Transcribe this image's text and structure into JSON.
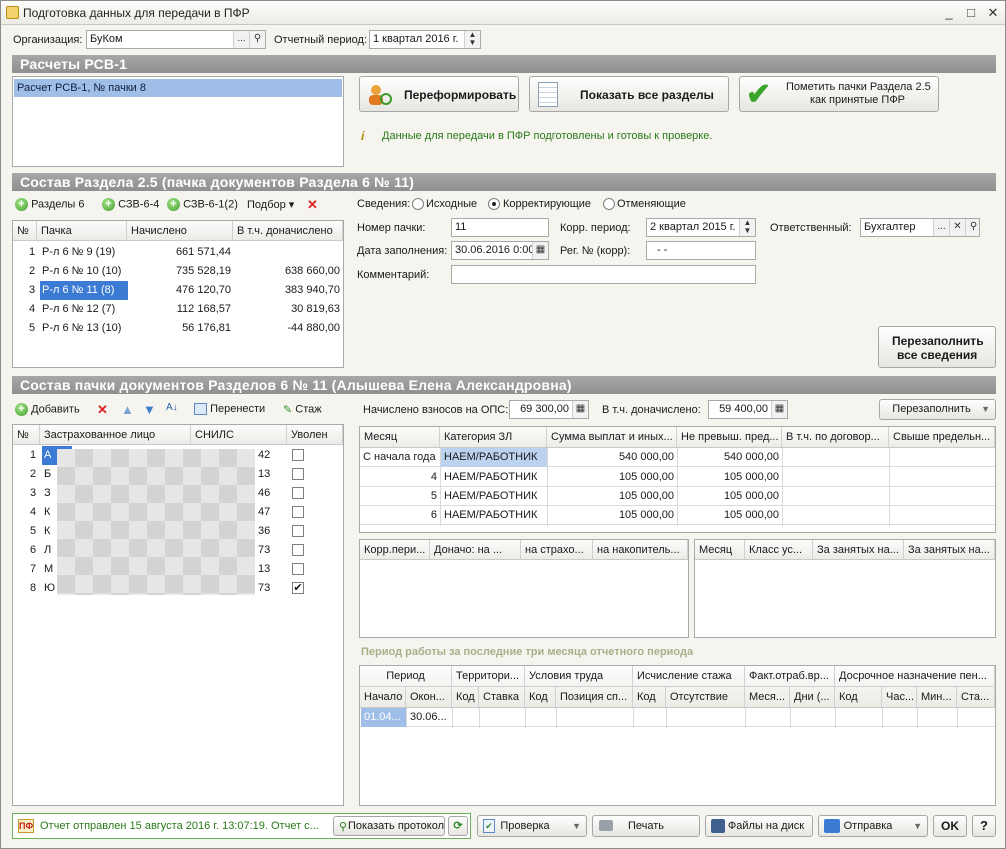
{
  "window": {
    "title": "Подготовка данных для передачи в ПФР"
  },
  "header": {
    "org_label": "Организация:",
    "org_value": "БуКом",
    "period_label": "Отчетный период:",
    "period_value": "1 квартал 2016 г."
  },
  "rsv": {
    "section_title": "Расчеты РСВ-1",
    "list_items": [
      "Расчет РСВ-1, № пачки 8"
    ],
    "reformat_label": "Переформировать",
    "show_all_label": "Показать все разделы",
    "mark_accepted_label_1": "Пометить пачки Раздела 2.5",
    "mark_accepted_label_2": "как принятые ПФР",
    "info_text": "Данные для передачи в ПФР подготовлены и готовы к проверке."
  },
  "section25": {
    "title": "Состав Раздела 2.5     (пачка документов Раздела 6 № 11)",
    "toolbar": {
      "razdely": "Разделы 6",
      "szv64": "СЗВ-6-4",
      "szv612": "СЗВ-6-1(2)",
      "podbor": "Подбор"
    },
    "columns": [
      "№",
      "Пачка",
      "Начислено",
      "В т.ч. доначислено"
    ],
    "rows": [
      {
        "n": "1",
        "pack": "Р-л 6 № 9 (19)",
        "accrued": "661 571,44",
        "extra": ""
      },
      {
        "n": "2",
        "pack": "Р-л 6 № 10 (10)",
        "accrued": "735 528,19",
        "extra": "638 660,00"
      },
      {
        "n": "3",
        "pack": "Р-л 6 № 11 (8)",
        "accrued": "476 120,70",
        "extra": "383 940,70"
      },
      {
        "n": "4",
        "pack": "Р-л 6 № 12 (7)",
        "accrued": "112 168,57",
        "extra": "30 819,63"
      },
      {
        "n": "5",
        "pack": "Р-л 6 № 13 (10)",
        "accrued": "56 176,81",
        "extra": "-44 880,00"
      }
    ],
    "svedeniya_label": "Сведения:",
    "radio_original": "Исходные",
    "radio_corrective": "Корректирующие",
    "radio_cancel": "Отменяющие",
    "pack_no_label": "Номер пачки:",
    "pack_no_value": "11",
    "corr_period_label": "Корр. период:",
    "corr_period_value": "2 квартал 2015 г.",
    "responsible_label": "Ответственный:",
    "responsible_value": "Бухгалтер",
    "fill_date_label": "Дата заполнения:",
    "fill_date_value": "30.06.2016  0:00",
    "reg_no_label": "Рег. № (корр):",
    "reg_no_value": "-   -",
    "comment_label": "Комментарий:",
    "comment_value": "",
    "refill_all_1": "Перезаполнить",
    "refill_all_2": "все сведения"
  },
  "section6": {
    "title": "Состав пачки документов Разделов 6 № 11          (Алышева Елена Александровна)",
    "toolbar": {
      "add": "Добавить",
      "move": "Перенести",
      "stazh": "Стаж"
    },
    "columns": [
      "№",
      "Застрахованное лицо",
      "СНИЛС",
      "Уволен"
    ],
    "rows": [
      {
        "n": "1",
        "name": "А",
        "snils": "42",
        "fired": false
      },
      {
        "n": "2",
        "name": "Б",
        "snils": "13",
        "fired": false
      },
      {
        "n": "3",
        "name": "З",
        "snils": "46",
        "fired": false
      },
      {
        "n": "4",
        "name": "К",
        "snils": "47",
        "fired": false
      },
      {
        "n": "5",
        "name": "К",
        "snils": "36",
        "fired": false
      },
      {
        "n": "6",
        "name": "Л",
        "snils": "73",
        "fired": false
      },
      {
        "n": "7",
        "name": "М",
        "snils": "13",
        "fired": false
      },
      {
        "n": "8",
        "name": "Ю",
        "snils": "73",
        "fired": true
      }
    ],
    "ops_label": "Начислено взносов на ОПС:",
    "ops_value": "69 300,00",
    "extra_label": "В т.ч. доначислено:",
    "extra_value": "59 400,00",
    "refill_label": "Перезаполнить",
    "pay_columns": [
      "Месяц",
      "Категория ЗЛ",
      "Сумма выплат и иных...",
      "Не превыш. пред...",
      "В т.ч. по договор...",
      "Свыше предельн..."
    ],
    "pay_rows": [
      {
        "month": "С начала года",
        "cat": "НАЕМ/РАБОТНИК",
        "sum": "540 000,00",
        "limit": "540 000,00",
        "contract": "",
        "over": ""
      },
      {
        "month": "4",
        "cat": "НАЕМ/РАБОТНИК",
        "sum": "105 000,00",
        "limit": "105 000,00",
        "contract": "",
        "over": ""
      },
      {
        "month": "5",
        "cat": "НАЕМ/РАБОТНИК",
        "sum": "105 000,00",
        "limit": "105 000,00",
        "contract": "",
        "over": ""
      },
      {
        "month": "6",
        "cat": "НАЕМ/РАБОТНИК",
        "sum": "105 000,00",
        "limit": "105 000,00",
        "contract": "",
        "over": ""
      }
    ],
    "corr_columns": [
      "Корр.пери...",
      "Доначо: на ...",
      "на страхо...",
      "на накопитель..."
    ],
    "class_columns": [
      "Месяц",
      "Класс ус...",
      "За занятых на...",
      "За занятых на..."
    ],
    "period_title": "Период работы за последние три месяца отчетного периода",
    "period_groups": [
      "Период",
      "Территори...",
      "Условия труда",
      "Исчисление стажа",
      "Факт.отраб.вр...",
      "Досрочное назначение пен..."
    ],
    "period_sub": [
      "Начало",
      "Окон...",
      "Код",
      "Ставка",
      "Код",
      "Позиция сп...",
      "Код",
      "Отсутствие",
      "Меся...",
      "Дни (...",
      "Код",
      "Час...",
      "Мин...",
      "Ста..."
    ],
    "period_row": {
      "start": "01.04...",
      "end": "30.06..."
    }
  },
  "footer": {
    "status_text": "Отчет отправлен 15 августа 2016 г. 13:07:19. Отчет с...",
    "show_protocol": "Показать протокол",
    "check": "Проверка",
    "print": "Печать",
    "files": "Файлы на диск",
    "send": "Отправка",
    "ok": "OK",
    "help": "?"
  },
  "colors": {
    "section_bar": "#999999",
    "selection": "#3b7bd4",
    "info_green": "#2a7a1a",
    "period_title": "#a8b08a"
  }
}
